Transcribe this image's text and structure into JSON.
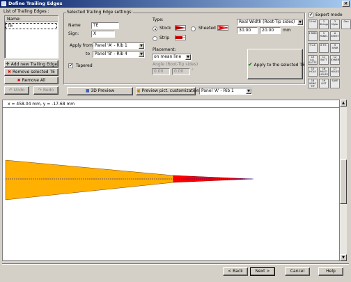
{
  "window": {
    "title": "Define Trailing Edges"
  },
  "left": {
    "list_title": "List of Trailing Edges :",
    "list_header": "Name:",
    "list_items": [
      "TE"
    ],
    "add_label": "Add new Trailing Edge",
    "remove_label": "Remove selected TE",
    "remove_all_label": "Remove All",
    "undo_label": "Undo",
    "redo_label": "Redo"
  },
  "settings": {
    "group_title": "Selected Trailing Edge settings:",
    "name_label": "Name",
    "name_value": "TE",
    "sign_label": "Sign:",
    "sign_value": "X",
    "apply_from_label": "Apply from",
    "apply_from_value": "Panel 'A' - Rib 1",
    "to_label": "to",
    "to_value": "Panel 'B' - Rib 4",
    "tapered_label": "Tapered",
    "tapered_checked": true
  },
  "type": {
    "label": "Type:",
    "stock_label": "Stock",
    "sheeted_label": "Sheeted",
    "strip_label": "Strip",
    "selected": "Stock"
  },
  "width": {
    "mode_value": "Real Width (Root-Tip sides)",
    "root_value": "30.00",
    "tip_value": "20.00",
    "unit": "mm"
  },
  "placement": {
    "label": "Placement:",
    "value": "on mean line",
    "angle_label": "Angle (Root-Tip sides)",
    "angle_root": "0.00",
    "angle_tip": "0.00",
    "angle_unit": "°"
  },
  "apply_button": "Apply to the selected TE",
  "expert": {
    "label": "Expert mode",
    "checked": true
  },
  "toolbar": {
    "preview3d_label": "3D Preview",
    "preview_pict_label": "Preview pict. customization",
    "panel_select_value": "Panel 'A' - Rib 1"
  },
  "tools": [
    "1 Hull",
    "2 Stringer",
    "3 Mylar",
    "Gen",
    "4 RIBS",
    "5 PANEL",
    "6 SHEET",
    "",
    "7 L.E.",
    "8 T.E.",
    "9 SPAR",
    "",
    "10 ALL. SLOTS",
    "11 BUTT",
    "12 JOINERS",
    "",
    "15 HOLE",
    "16 MULTI HOLES",
    "17 HOLES",
    "",
    "18 WING TIP",
    "19 LIST",
    "SAVE",
    ""
  ],
  "canvas": {
    "coords": "x = 458.04 mm, y = -17.68 mm",
    "colors": {
      "stock": "#ffb000",
      "taper": "#ff0000",
      "mean_line": "#0000c0"
    }
  },
  "footer": {
    "back_label": "< Back",
    "next_label": "Next >",
    "cancel_label": "Cancel",
    "help_label": "Help"
  }
}
